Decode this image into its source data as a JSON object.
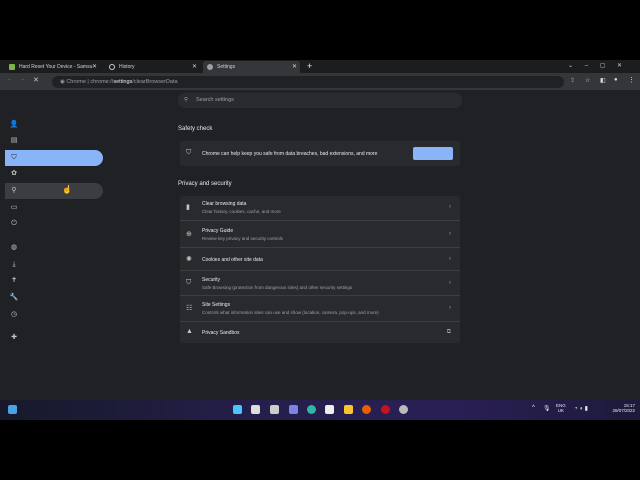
{
  "tabs": [
    {
      "title": "Hard Reset Your Device - Samsu",
      "active": false
    },
    {
      "title": "History",
      "active": false
    },
    {
      "title": "Settings",
      "active": true
    }
  ],
  "new_tab": "+",
  "window_controls": [
    "chevron-down-icon",
    "minimize-icon",
    "maximize-icon",
    "close-icon"
  ],
  "address": {
    "prefix": "Chrome",
    "sep": "|",
    "scheme": "chrome://",
    "host": "settings",
    "path": "/clearBrowserData"
  },
  "search": {
    "placeholder": "Search settings"
  },
  "sidebar": [
    "person-icon",
    "autofill-icon",
    "shield-icon",
    "palette-icon",
    "search-icon",
    "browser-icon",
    "power-icon",
    "globe-icon",
    "download-icon",
    "accessibility-icon",
    "wrench-icon",
    "history-icon",
    "extensions-icon"
  ],
  "sidebar_selected": 2,
  "safety": {
    "heading": "Safety check",
    "text": "Chrome can help keep you safe from data breaches, bad extensions, and more",
    "button_color": "#8ab4f8"
  },
  "privacy": {
    "heading": "Privacy and security",
    "rows": [
      {
        "title": "Clear browsing data",
        "sub": "Clear history, cookies, cache, and more",
        "icon": "trash-icon"
      },
      {
        "title": "Privacy Guide",
        "sub": "Review key privacy and security controls",
        "icon": "compass-icon"
      },
      {
        "title": "Cookies and other site data",
        "sub": "",
        "icon": "cookie-icon"
      },
      {
        "title": "Security",
        "sub": "Safe Browsing (protection from dangerous sites) and other security settings",
        "icon": "shield-icon"
      },
      {
        "title": "Site Settings",
        "sub": "Controls what information sites can use and show (location, camera, pop-ups, and more)",
        "icon": "sliders-icon"
      },
      {
        "title": "Privacy Sandbox",
        "sub": "",
        "icon": "sandbox-icon"
      }
    ]
  },
  "taskbar": {
    "lang": "ENG",
    "region": "UK",
    "time": "15:17",
    "date": "28/07/2022"
  }
}
